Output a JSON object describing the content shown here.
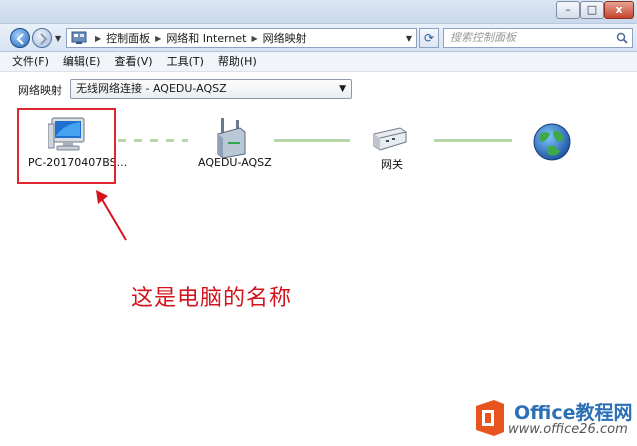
{
  "window": {
    "min_glyph": "–",
    "max_glyph": "□",
    "close_glyph": "x"
  },
  "nav": {
    "breadcrumbs": [
      "控制面板",
      "网络和 Internet",
      "网络映射"
    ],
    "search_placeholder": "搜索控制面板"
  },
  "menu": {
    "items": [
      "文件(F)",
      "编辑(E)",
      "查看(V)",
      "工具(T)",
      "帮助(H)"
    ]
  },
  "toolbar": {
    "label": "网络映射",
    "selected_network": "无线网络连接 - AQEDU-AQSZ"
  },
  "map": {
    "nodes": [
      {
        "label": "PC-20170407BS...",
        "icon": "computer-icon"
      },
      {
        "label": "AQEDU-AQSZ",
        "icon": "wireless-router-icon"
      },
      {
        "label": "网关",
        "icon": "gateway-icon"
      },
      {
        "label": "",
        "icon": "internet-globe-icon"
      }
    ]
  },
  "annotation": {
    "text": "这是电脑的名称"
  },
  "watermark": {
    "brand": "Office教程网",
    "url": "www.office26.com"
  },
  "colors": {
    "annotation_red": "#d3141c",
    "link_green": "#b4d7a8",
    "accent_blue": "#2b6fb6"
  }
}
